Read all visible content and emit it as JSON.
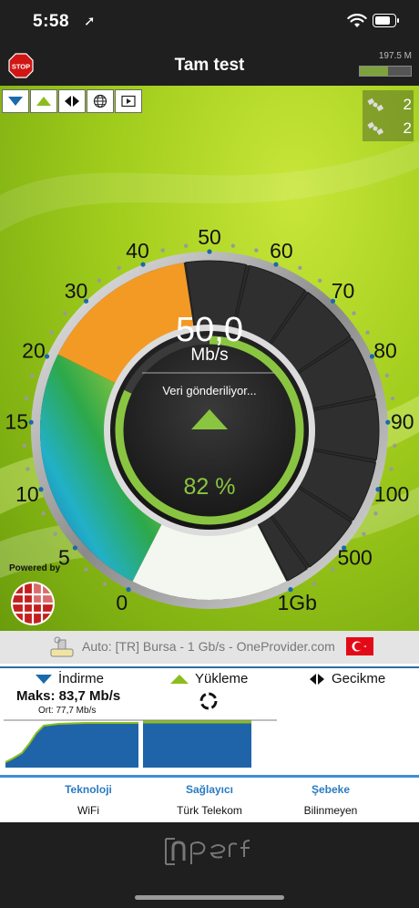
{
  "status_bar": {
    "time": "5:58"
  },
  "nav": {
    "title": "Tam test",
    "data_used": "197.5 M",
    "data_used_fraction": 0.55
  },
  "servers": [
    {
      "count": "2"
    },
    {
      "count": "2"
    }
  ],
  "gauge": {
    "scale_labels": [
      "0",
      "5",
      "10",
      "15",
      "20",
      "30",
      "40",
      "50",
      "60",
      "70",
      "80",
      "90",
      "100",
      "500",
      "1Gb"
    ],
    "speed_value": "50,0",
    "speed_unit": "Mb/s",
    "status_text": "Veri gönderiliyor...",
    "progress_text": "82 %",
    "progress_fraction": 0.82
  },
  "powered_by": "Powered by",
  "server_info": "Auto: [TR] Bursa - 1 Gb/s - OneProvider.com",
  "legend": {
    "download": "İndirme",
    "upload": "Yükleme",
    "latency": "Gecikme"
  },
  "stats": {
    "max": "Maks: 83,7 Mb/s",
    "avg": "Ort: 77,7 Mb/s"
  },
  "info": [
    {
      "title": "Teknoloji",
      "value": "WiFi"
    },
    {
      "title": "Sağlayıcı",
      "value": "Türk Telekom"
    },
    {
      "title": "Şebeke",
      "value": "Bilinmeyen"
    }
  ],
  "colors": {
    "bar_bg": "#1f1f1f",
    "accent_green": "#8bbd1e",
    "download_blue": "#1a6aac",
    "info_blue": "#2a7bc0"
  },
  "icons": {
    "stop": "stop-sign-icon",
    "download": "triangle-down-icon",
    "upload": "triangle-up-icon",
    "latency": "double-arrow-icon",
    "globe": "globe-icon",
    "video": "video-icon",
    "server": "satellite-icon",
    "flag": "turkey-flag-icon",
    "loader": "loading-spinner-icon"
  }
}
